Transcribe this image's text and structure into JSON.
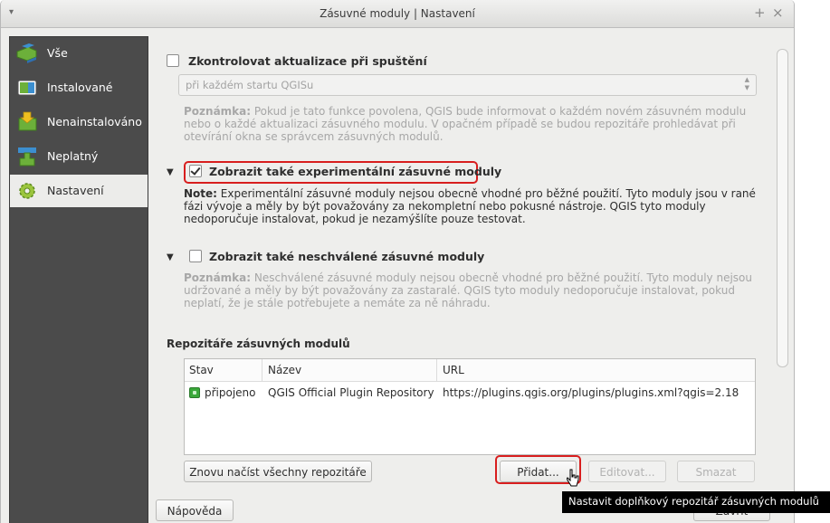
{
  "window": {
    "title": "Zásuvné moduly | Nastavení",
    "buttons": {
      "maximize": "+",
      "close": "×"
    },
    "menu_glyph": "▾"
  },
  "sidebar": {
    "items": [
      {
        "label": "Vše",
        "icon": "puzzle-stack-icon",
        "selected": false
      },
      {
        "label": "Instalované",
        "icon": "puzzle-installed-icon",
        "selected": false
      },
      {
        "label": "Nenainstalováno",
        "icon": "puzzle-download-icon",
        "selected": false
      },
      {
        "label": "Neplatný",
        "icon": "puzzle-invalid-icon",
        "selected": false
      },
      {
        "label": "Nastavení",
        "icon": "gear-icon",
        "selected": true
      }
    ]
  },
  "settings": {
    "check_updates": {
      "label": "Zkontrolovat aktualizace při spuštění",
      "checked": false
    },
    "update_interval": {
      "value": "při každém startu QGISu"
    },
    "update_note": {
      "prefix": "Poznámka:",
      "text": "Pokud je tato funkce povolena, QGIS bude informovat o každém novém zásuvném modulu nebo o každé aktualizaci zásuvného modulu. V opačném případě se budou repozitáře prohledávat při otevírání okna se správcem zásuvných modulů."
    },
    "experimental": {
      "label": "Zobrazit také experimentální zásuvné moduly",
      "checked": true
    },
    "experimental_note": {
      "prefix": "Note:",
      "text": "Experimentální zásuvné moduly nejsou obecně vhodné pro běžné použití. Tyto moduly jsou v rané fázi vývoje a měly by být považovány za nekompletní nebo pokusné nástroje. QGIS tyto moduly nedoporučuje instalovat, pokud je nezamýšlíte pouze testovat."
    },
    "deprecated": {
      "label": "Zobrazit také neschválené zásuvné moduly",
      "checked": false
    },
    "deprecated_note": {
      "prefix": "Poznámka:",
      "text": "Neschválené zásuvné moduly nejsou obecně vhodné pro běžné použití. Tyto moduly nejsou udržované a měly by být považovány za zastaralé. QGIS tyto moduly nedoporučuje instalovat, pokud neplatí, že je stále potřebujete a nemáte za ně náhradu."
    },
    "repositories": {
      "label": "Repozitáře zásuvných modulů",
      "columns": [
        "Stav",
        "Název",
        "URL"
      ],
      "rows": [
        {
          "status": "připojeno",
          "name": "QGIS Official Plugin Repository",
          "url": "https://plugins.qgis.org/plugins/plugins.xml?qgis=2.18"
        }
      ],
      "buttons": {
        "reload": "Znovu načíst všechny repozitáře",
        "add": "Přidat...",
        "edit": "Editovat...",
        "delete": "Smazat"
      }
    }
  },
  "footer": {
    "help": "Nápověda",
    "close": "Zavřít"
  },
  "tooltip": {
    "text": "Nastavit doplňkový repozitář zásuvných modulů"
  },
  "colors": {
    "highlight": "#d81e1e",
    "sidebar_bg": "#4b4b4b",
    "tooltip_bg": "#000000"
  }
}
